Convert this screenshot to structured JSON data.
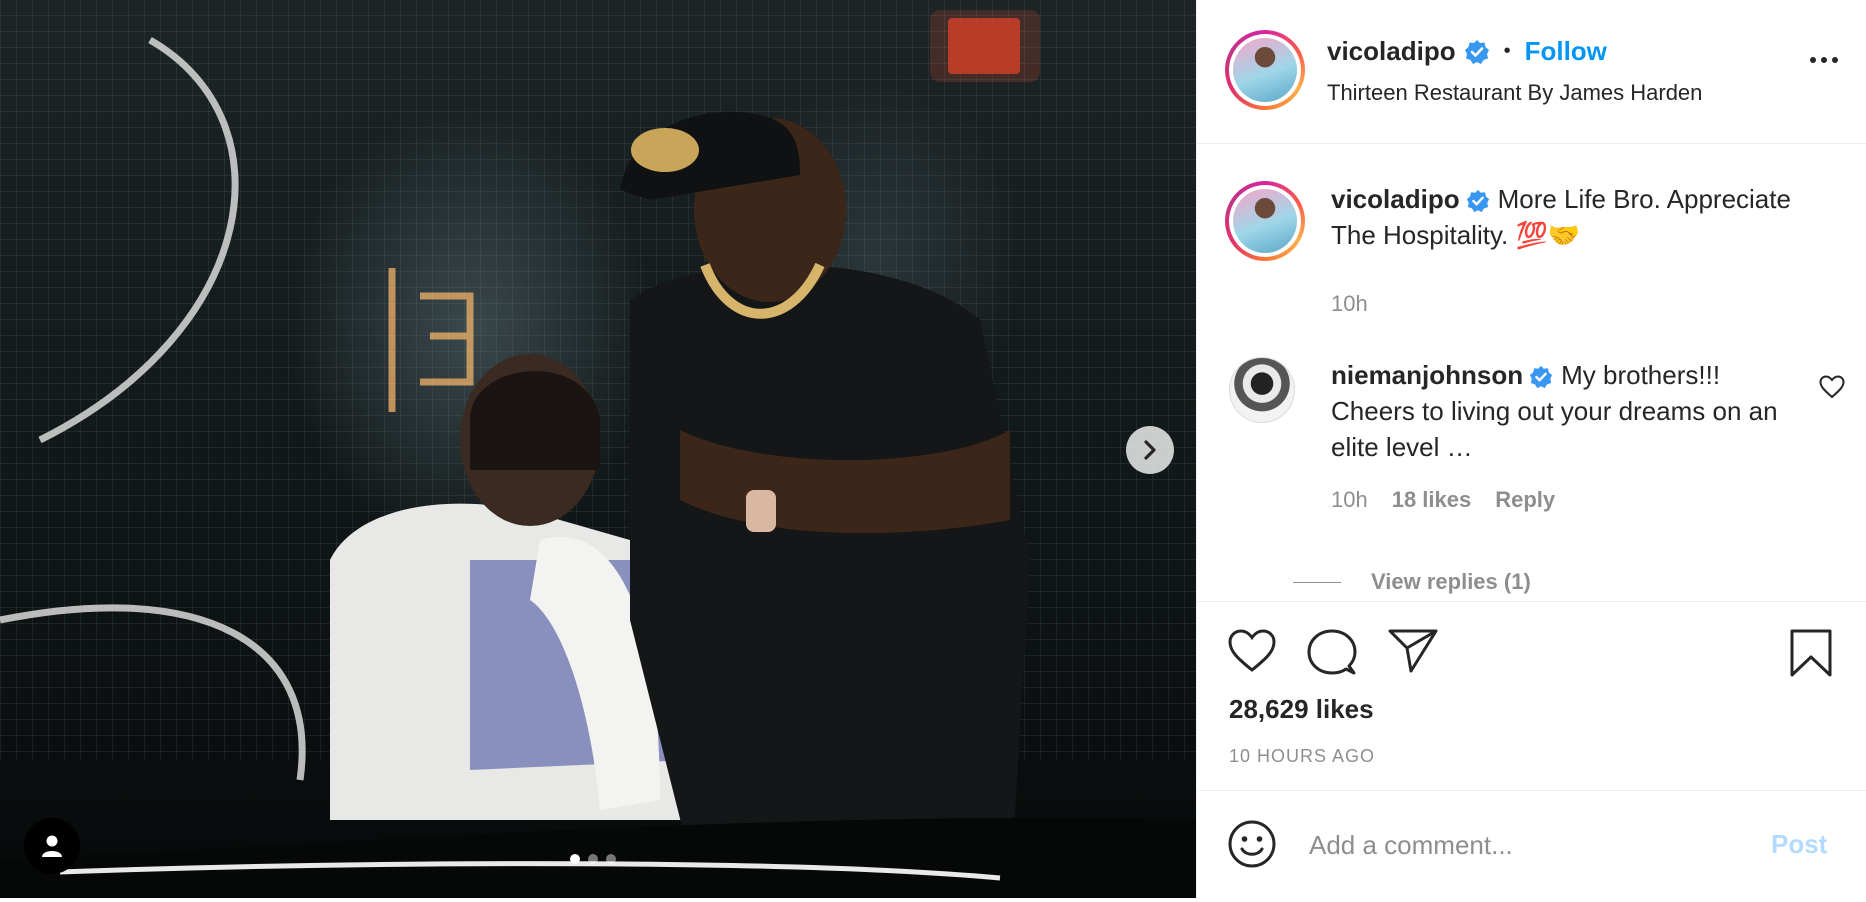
{
  "post": {
    "username": "vicoladipo",
    "follow_label": "Follow",
    "separator": "•",
    "location": "Thirteen Restaurant By James Harden",
    "image_alt": "Photo of two men posing in a dim restaurant booth",
    "carousel": {
      "slides": 3,
      "active_index": 0
    }
  },
  "caption": {
    "username": "vicoladipo",
    "text": "More Life Bro. Appreciate The Hospitality. 💯🤝",
    "time": "10h"
  },
  "comments": [
    {
      "username": "niemanjohnson",
      "text": "My brothers!!! Cheers to living out your dreams on an elite level …",
      "time": "10h",
      "likes": "18 likes",
      "reply_label": "Reply"
    }
  ],
  "view_replies": "View replies (1)",
  "stats": {
    "likes": "28,629 likes",
    "posted": "10 HOURS AGO"
  },
  "add_comment": {
    "placeholder": "Add a comment...",
    "post_label": "Post"
  },
  "colors": {
    "accent": "#0095f6",
    "verified": "#3897f0",
    "muted": "#8e8e8e",
    "post_disabled": "#b3dbff"
  },
  "icons": {
    "like": "heart-icon",
    "comment": "comment-bubble-icon",
    "share": "paper-plane-icon",
    "save": "bookmark-icon",
    "more": "more-options-icon",
    "emoji": "emoji-icon",
    "next": "chevron-right-icon",
    "user_tag": "user-tag-icon"
  }
}
